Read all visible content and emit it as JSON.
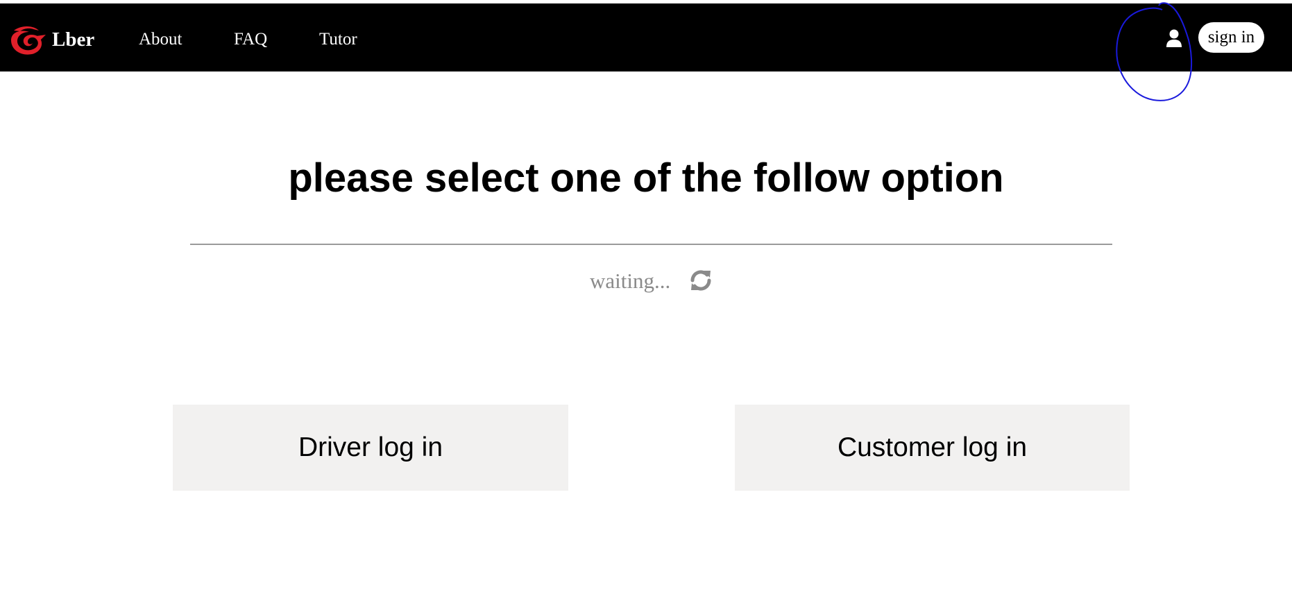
{
  "header": {
    "brand": "Lber",
    "brand_logo": "red-swirl-logo",
    "nav": [
      {
        "label": "About"
      },
      {
        "label": "FAQ"
      },
      {
        "label": "Tutor"
      }
    ],
    "user_icon": "user-icon",
    "signin_label": "sign in"
  },
  "main": {
    "title": "please select one of the follow option",
    "status_text": "waiting...",
    "status_icon": "refresh-icon",
    "options": [
      {
        "label": "Driver log in"
      },
      {
        "label": "Customer log in"
      }
    ]
  },
  "colors": {
    "topbar": "#000000",
    "logo": "#e0202a",
    "annotation": "#1a1adc",
    "option_bg": "#f2f1f0",
    "status": "#8a8a8a"
  }
}
